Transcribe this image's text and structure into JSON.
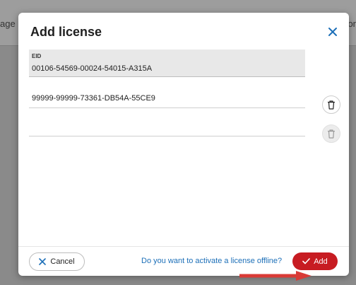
{
  "background": {
    "left_text": "age",
    "right_text": "or"
  },
  "dialog": {
    "title": "Add license",
    "close_icon": "close-icon",
    "eid_label": "EID",
    "eid_value": "00106-54569-00024-54015-A315A",
    "license_fields": [
      {
        "value": "99999-99999-73361-DB54A-55CE9"
      },
      {
        "value": ""
      }
    ],
    "trash_icon": "trash-icon",
    "cancel_label": "Cancel",
    "cancel_icon": "x-icon",
    "offline_link": "Do you want to activate a license offline?",
    "add_label": "Add",
    "add_icon": "check-icon",
    "colors": {
      "accent_red": "#c71c22",
      "link_blue": "#1c6fb8"
    }
  }
}
